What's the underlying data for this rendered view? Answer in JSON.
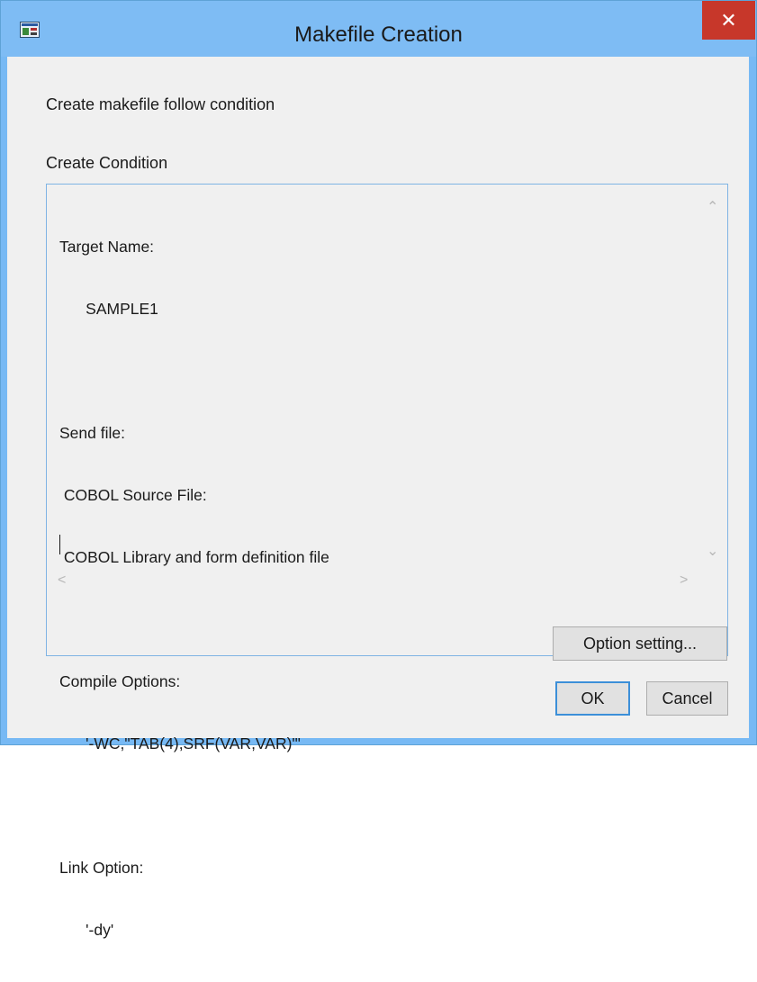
{
  "window": {
    "title": "Makefile Creation",
    "close_glyph": "✕",
    "icon": "makefile-app-icon"
  },
  "dialog": {
    "instruction": "Create makefile follow condition",
    "condition_label": "Create Condition"
  },
  "condition_text": {
    "lines": [
      "Target Name:",
      "      SAMPLE1",
      "",
      "Send file:",
      " COBOL Source File:",
      " COBOL Library and form definition file",
      "",
      "Compile Options:",
      "      '-WC,\"TAB(4),SRF(VAR,VAR)\"'",
      "",
      "Link Option:",
      "      '-dy'"
    ]
  },
  "buttons": {
    "option_setting": "Option setting...",
    "ok": "OK",
    "cancel": "Cancel"
  },
  "colors": {
    "titlebar": "#7ebcf4",
    "close_button": "#c7372a",
    "client_background": "#f0f0f0",
    "focus_border": "#3c8fd8"
  }
}
